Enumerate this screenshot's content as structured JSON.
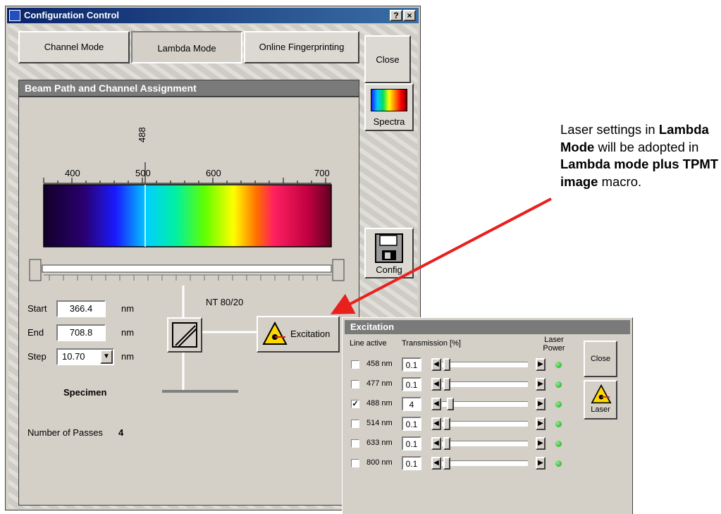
{
  "window": {
    "title": "Configuration Control",
    "help_btn": "?",
    "close_btn": "×"
  },
  "modes": [
    {
      "label": "Channel Mode"
    },
    {
      "label": "Lambda Mode"
    },
    {
      "label": "Online Fingerprinting"
    }
  ],
  "side_buttons": {
    "close": "Close",
    "spectra": "Spectra",
    "config": "Config"
  },
  "panel": {
    "title": "Beam Path and Channel Assignment",
    "marker": "488",
    "ticks": [
      "400",
      "500",
      "600",
      "700"
    ],
    "start_label": "Start",
    "start_value": "366.4",
    "end_label": "End",
    "end_value": "708.8",
    "step_label": "Step",
    "step_value": "10.70",
    "unit": "nm",
    "beamsplitter": "NT 80/20",
    "excitation_btn": "Excitation",
    "specimen": "Specimen",
    "passes_label": "Number of Passes",
    "passes_value": "4"
  },
  "excitation": {
    "title": "Excitation",
    "col_line_active": "Line active",
    "col_transmission": "Transmission [%]",
    "col_laser_power_1": "Laser",
    "col_laser_power_2": "Power",
    "close": "Close",
    "laser": "Laser",
    "lines": [
      {
        "label": "458 nm",
        "active": false,
        "transmission": "0.1",
        "level": 0.001
      },
      {
        "label": "477 nm",
        "active": false,
        "transmission": "0.1",
        "level": 0.001
      },
      {
        "label": "488 nm",
        "active": true,
        "transmission": "4",
        "level": 0.04
      },
      {
        "label": "514 nm",
        "active": false,
        "transmission": "0.1",
        "level": 0.001
      },
      {
        "label": "633 nm",
        "active": false,
        "transmission": "0.1",
        "level": 0.001
      },
      {
        "label": "800 nm",
        "active": false,
        "transmission": "0.1",
        "level": 0.001
      }
    ]
  },
  "annotation": {
    "p1": "Laser settings in ",
    "b1": "Lambda Mode",
    "p2": " will be adopted in ",
    "b2": "Lambda mode plus TPMT image",
    "p3": " macro."
  },
  "colors": {
    "arrow": "#e8201e",
    "title_bar": "#0a246a",
    "led": "#22aa22"
  }
}
